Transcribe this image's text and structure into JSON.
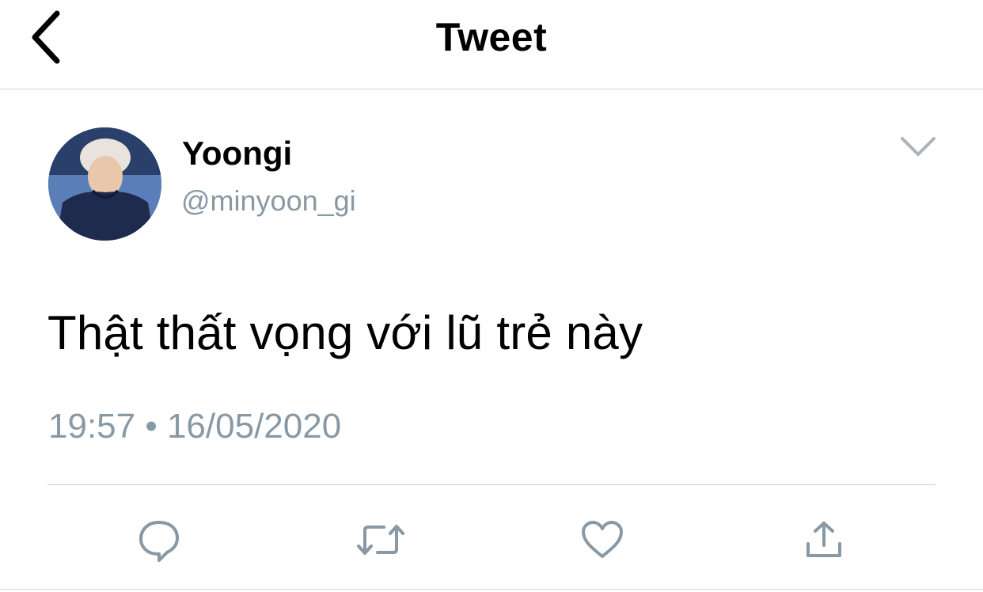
{
  "header": {
    "title": "Tweet",
    "back_icon": "chevron-left-icon"
  },
  "author": {
    "display_name": "Yoongi",
    "handle": "@minyoon_gi",
    "avatar_icon": "avatar-photo"
  },
  "tweet": {
    "text": "Thật thất vọng với lũ trẻ này",
    "timestamp": "19:57 • 16/05/2020"
  },
  "actions": [
    {
      "name": "reply",
      "icon": "reply-icon"
    },
    {
      "name": "retweet",
      "icon": "retweet-icon"
    },
    {
      "name": "like",
      "icon": "heart-icon"
    },
    {
      "name": "share",
      "icon": "share-icon"
    }
  ],
  "colors": {
    "text_primary": "#000000",
    "text_secondary": "#8899a6",
    "icon_gray": "#8899a6",
    "divider": "#cfd3d7"
  }
}
